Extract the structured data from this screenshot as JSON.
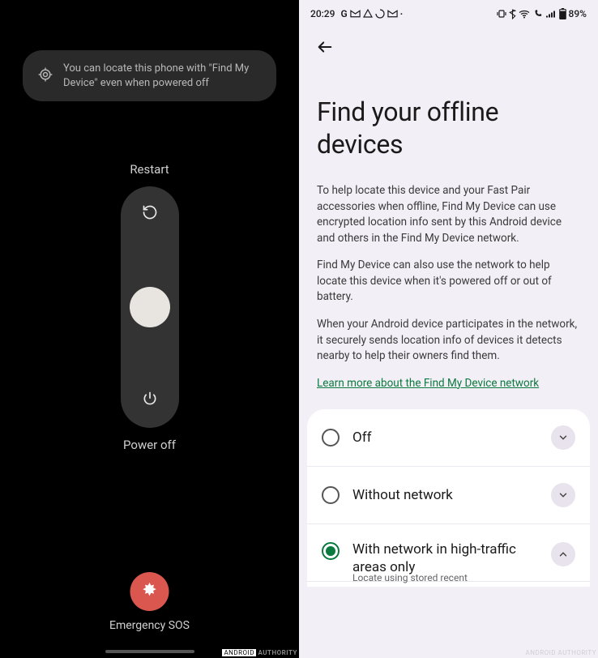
{
  "left": {
    "hint": "You can locate this phone with \"Find My Device\" even when powered off",
    "restart_label": "Restart",
    "poweroff_label": "Power off",
    "sos_label": "Emergency SOS",
    "watermark_brand": "ANDROID",
    "watermark_text": "AUTHORITY"
  },
  "right": {
    "status": {
      "time": "20:29",
      "battery": "89%"
    },
    "title": "Find your offline devices",
    "para1": "To help locate this device and your Fast Pair accessories when offline, Find My Device can use encrypted location info sent by this Android device and others in the Find My Device network.",
    "para2": "Find My Device can also use the network to help locate this device when it's powered off or out of battery.",
    "para3": "When your Android device participates in the network, it securely sends location info of devices it detects nearby to help their owners find them.",
    "learn_more": "Learn more about the Find My Device network",
    "options": [
      {
        "label": "Off",
        "checked": false,
        "expanded": false
      },
      {
        "label": "Without network",
        "checked": false,
        "expanded": false
      },
      {
        "label": "With network in high-traffic areas only",
        "checked": true,
        "expanded": true
      }
    ],
    "option3_sub": "Locate using stored recent"
  }
}
